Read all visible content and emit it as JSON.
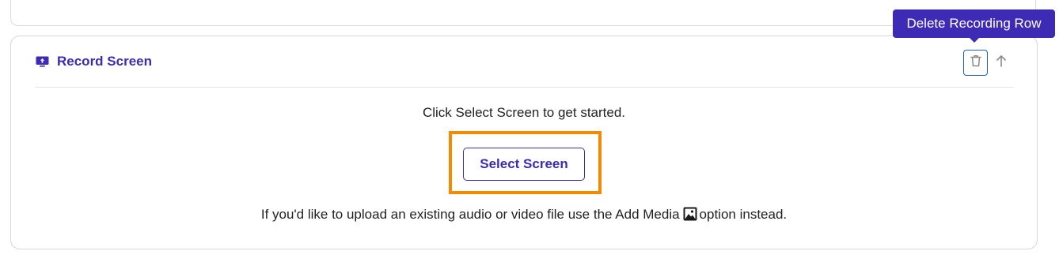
{
  "recording_row": {
    "title": "Record Screen",
    "title_icon": "screen-share-icon",
    "delete_icon": "trash-icon",
    "move_up_icon": "arrow-up-icon",
    "tooltip": "Delete Recording Row",
    "prompt": "Click Select Screen to get started.",
    "select_button_label": "Select Screen",
    "footer_before": "If you'd like to upload an existing audio or video file use the Add Media",
    "footer_icon": "image-icon",
    "footer_after": "option instead."
  },
  "colors": {
    "accent": "#3d2bb5",
    "delete_focus_border": "#1d5fc4",
    "highlight": "#f28b00",
    "text": "#222222",
    "border": "#d6d6dc"
  }
}
